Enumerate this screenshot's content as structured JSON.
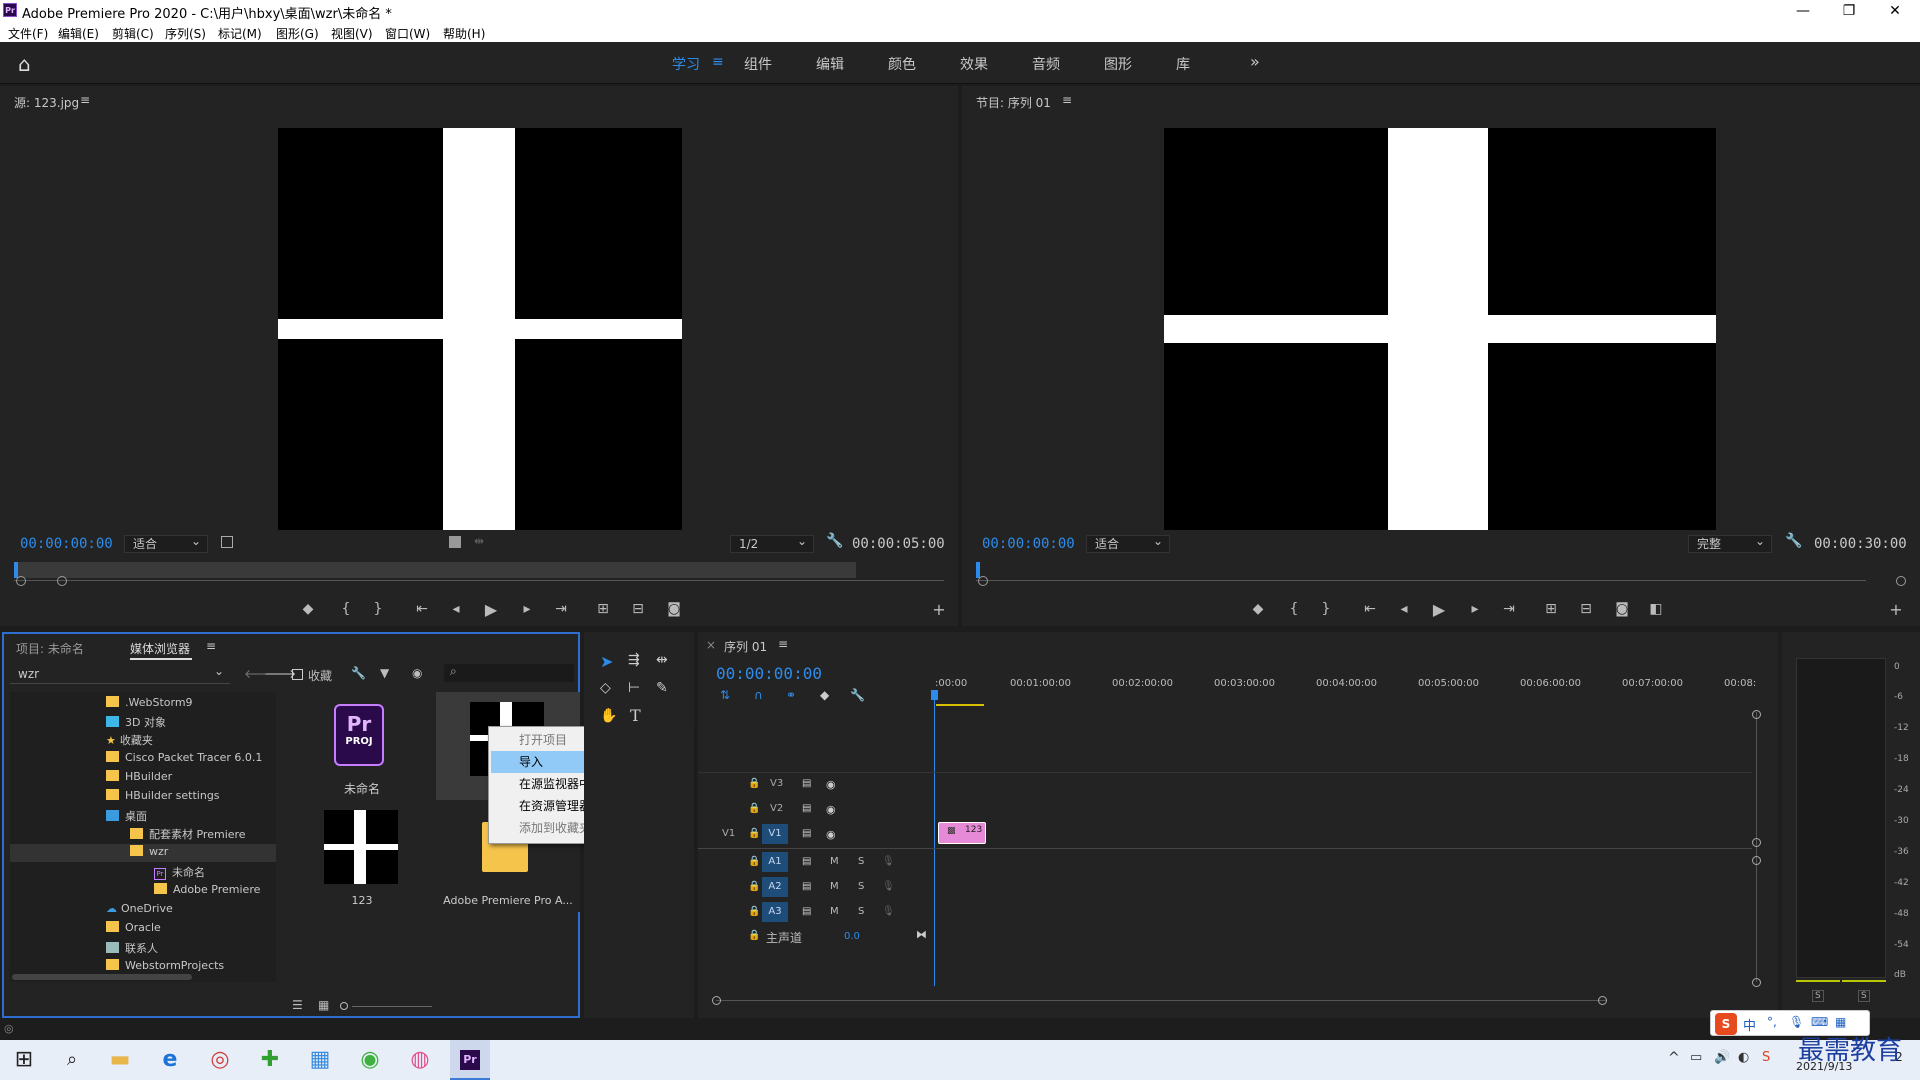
{
  "window": {
    "title": "Adobe Premiere Pro 2020 - C:\\用户\\hbxy\\桌面\\wzr\\未命名 *",
    "logo": "Pr"
  },
  "menu": [
    "文件(F)",
    "编辑(E)",
    "剪辑(C)",
    "序列(S)",
    "标记(M)",
    "图形(G)",
    "视图(V)",
    "窗口(W)",
    "帮助(H)"
  ],
  "workspaces": {
    "active": "学习",
    "items": [
      "组件",
      "编辑",
      "颜色",
      "效果",
      "音频",
      "图形",
      "库"
    ]
  },
  "source": {
    "title": "源: 123.jpg",
    "timecode": "00:00:00:00",
    "fit": "适合",
    "resolution": "1/2",
    "duration": "00:00:05:00"
  },
  "program": {
    "title": "节目: 序列 01",
    "timecode": "00:00:00:00",
    "fit": "适合",
    "quality": "完整",
    "duration": "00:00:30:00"
  },
  "project": {
    "tab1": "项目: 未命名",
    "tab2": "媒体浏览器",
    "path_dropdown": "wzr",
    "favorites_label": "收藏",
    "tree": [
      {
        "label": ".WebStorm9",
        "icon": "folder"
      },
      {
        "label": "3D 对象",
        "icon": "cube"
      },
      {
        "label": "收藏夹",
        "icon": "star"
      },
      {
        "label": "Cisco Packet Tracer 6.0.1",
        "icon": "folder"
      },
      {
        "label": "HBuilder",
        "icon": "folder"
      },
      {
        "label": "HBuilder settings",
        "icon": "folder"
      },
      {
        "label": "桌面",
        "icon": "folder-blue"
      },
      {
        "label": "配套素材 Premiere",
        "icon": "folder"
      },
      {
        "label": "wzr",
        "icon": "folder"
      },
      {
        "label": "未命名",
        "icon": "pr"
      },
      {
        "label": "Adobe Premiere",
        "icon": "folder"
      },
      {
        "label": "OneDrive",
        "icon": "cloud"
      },
      {
        "label": "Oracle",
        "icon": "folder"
      },
      {
        "label": "联系人",
        "icon": "contacts"
      },
      {
        "label": "WebstormProjects",
        "icon": "folder"
      }
    ],
    "items": [
      {
        "name": "未命名",
        "badge_top": "Pr",
        "badge_bottom": "PROJ"
      },
      {
        "name": "123"
      },
      {
        "name": "Adobe Premiere Pro A..."
      }
    ]
  },
  "context_menu": [
    "打开项目",
    "导入",
    "在源监视器中打开",
    "在资源管理器中显示",
    "添加到收藏夹"
  ],
  "context_menu_selected": "导入",
  "timeline": {
    "tab": "序列 01",
    "timecode": "00:00:00:00",
    "ruler": [
      ":00:00",
      "00:01:00:00",
      "00:02:00:00",
      "00:03:00:00",
      "00:04:00:00",
      "00:05:00:00",
      "00:06:00:00",
      "00:07:00:00",
      "00:08:"
    ],
    "video_tracks": [
      "V3",
      "V2",
      "V1"
    ],
    "audio_tracks": [
      "A1",
      "A2",
      "A3"
    ],
    "source_patch": "V1",
    "mute": "M",
    "solo": "S",
    "master_label": "主声道",
    "master_value": "0.0",
    "clip": "123"
  },
  "meters": {
    "labels": [
      "0",
      "-6",
      "-12",
      "-18",
      "-24",
      "-30",
      "-36",
      "-42",
      "-48",
      "-54",
      "dB"
    ],
    "solo": [
      "S",
      "S"
    ]
  },
  "tray": {
    "ime": "中",
    "date": "2021/9/13",
    "notifications": "2",
    "watermark": "最需教育"
  }
}
